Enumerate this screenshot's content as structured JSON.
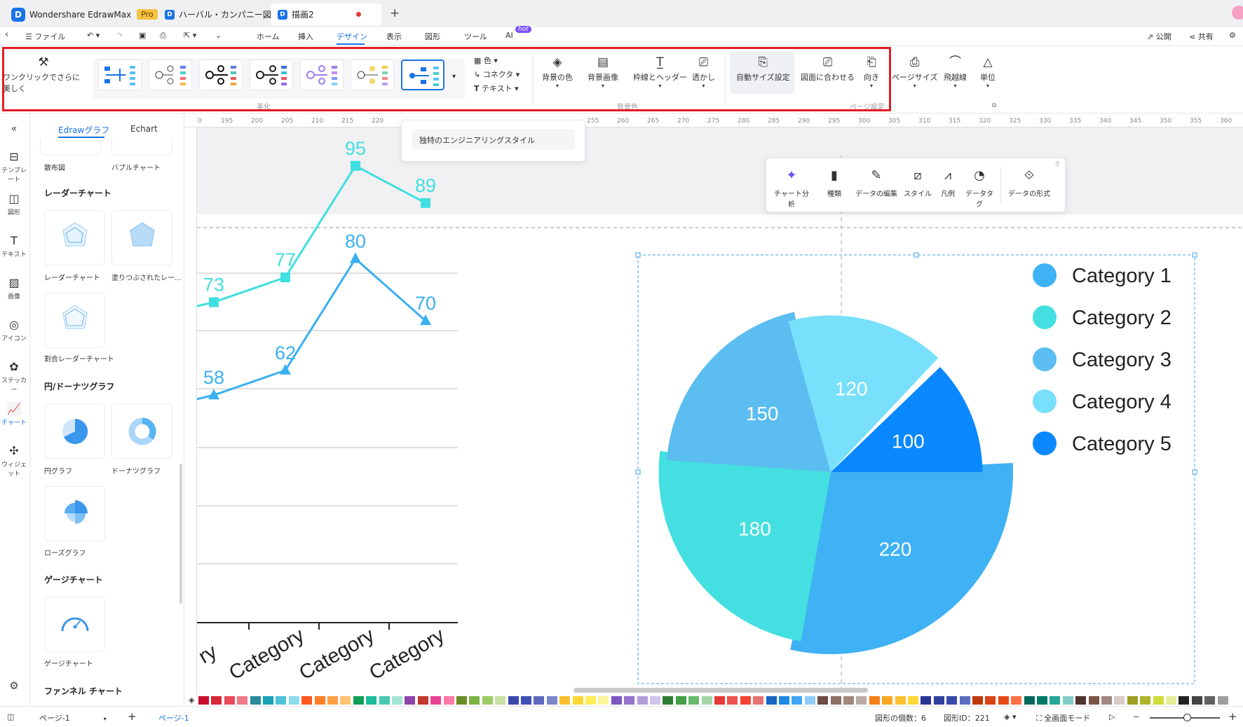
{
  "app": {
    "name": "Wondershare EdrawMax",
    "badge": "Pro"
  },
  "tabs": [
    {
      "label": "ハーバル・カンパニー図"
    },
    {
      "label": "描画2"
    }
  ],
  "menu": {
    "file": "ファイル",
    "items": [
      "ホーム",
      "挿入",
      "デザイン",
      "表示",
      "図形",
      "ツール",
      "AI"
    ],
    "ai_badge": "hot",
    "publish": "公開",
    "share": "共有"
  },
  "ribbon": {
    "beautify": "ワンクリックでさらに美しく",
    "color": "色",
    "connector": "コネクタ",
    "text": "テキスト",
    "bg_color": "背景の色",
    "bg_image": "背景画像",
    "border_header": "枠線とヘッダー",
    "watermark": "透かし",
    "auto_size": "自動サイズ設定",
    "fit_drawing": "図面に合わせる",
    "orientation": "向き",
    "page_size": "ページサイズ",
    "jump_line": "飛越線",
    "unit": "単位",
    "group_beautify": "美化",
    "group_background": "背景色",
    "group_page": "ページ設定"
  },
  "tooltip": "独特のエンジニアリングスタイル",
  "left_sidebar": [
    "テンプレート",
    "図形",
    "テキスト",
    "画像",
    "アイコン",
    "ステッカー",
    "チャート",
    "ウィジェット"
  ],
  "panel": {
    "tabs": [
      "Edrawグラフ",
      "Echart"
    ],
    "top_items": [
      "散布図",
      "バブルチャート"
    ],
    "sections": {
      "radar": "レーダーチャート",
      "pie": "円/ドーナツグラフ",
      "gauge": "ゲージチャート",
      "funnel": "ファンネル チャート"
    },
    "radar_items": [
      "レーダーチャート",
      "塗りつぶされたレー...",
      "割合レーダーチャート"
    ],
    "pie_items": [
      "円グラフ",
      "ドーナツグラフ",
      "ローズグラフ"
    ],
    "gauge_items": [
      "ゲージチャート"
    ]
  },
  "float_toolbar": [
    "チャート分析",
    "種類",
    "データの編集",
    "スタイル",
    "凡例",
    "データタグ",
    "データの形式"
  ],
  "ruler_ticks": [
    "0",
    "195",
    "200",
    "205",
    "210",
    "215",
    "220",
    "255",
    "260",
    "265",
    "270",
    "275",
    "280",
    "285",
    "290",
    "295",
    "300",
    "305",
    "310",
    "315",
    "320",
    "325",
    "330",
    "335",
    "340",
    "345",
    "350",
    "355",
    "360"
  ],
  "chart_data": [
    {
      "type": "line",
      "categories": [
        "Category",
        "Category",
        "Category",
        "Category"
      ],
      "series": [
        {
          "values": [
            73,
            77,
            95,
            89
          ],
          "color": "#40dfe0"
        },
        {
          "values": [
            58,
            62,
            80,
            70
          ],
          "color": "#3ab0f0"
        }
      ],
      "partial_tick_label": "ry"
    },
    {
      "type": "pie",
      "variant": "rose",
      "categories": [
        "Category 1",
        "Category 2",
        "Category 3",
        "Category 4",
        "Category 5"
      ],
      "values": [
        220,
        180,
        150,
        120,
        100
      ],
      "colors": [
        "#3fb1f5",
        "#44dfe0",
        "#5bbdf0",
        "#78e0fb",
        "#0a88ff"
      ],
      "legend": "right"
    }
  ],
  "status": {
    "page_select": "ページ-1",
    "page_tab": "ページ-1",
    "shape_count": "図形の個数：6",
    "shape_id": "図形ID：221",
    "fullscreen": "全画面モード"
  }
}
